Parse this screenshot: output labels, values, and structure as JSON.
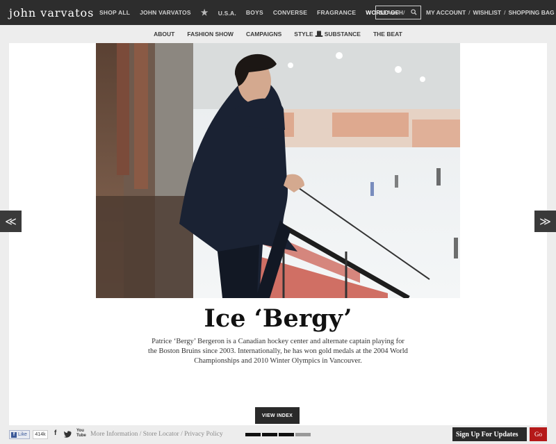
{
  "brand": {
    "logo_text": "john varvatos"
  },
  "nav": {
    "items": [
      "SHOP ALL",
      "JOHN VARVATOS",
      "U.S.A.",
      "BOYS",
      "CONVERSE",
      "FRAGRANCE",
      "WORLD OF"
    ],
    "slash": "/",
    "search_label": "SEARCH",
    "right_links": [
      "MY ACCOUNT",
      "WISHLIST",
      "SHOPPING BAG"
    ],
    "sep": "/"
  },
  "subnav": {
    "items": [
      "ABOUT",
      "FASHION SHOW",
      "CAMPAIGNS"
    ],
    "style_label": "STYLE",
    "substance_label": "SUBSTANCE",
    "last_item": "THE BEAT"
  },
  "feature": {
    "title": "Ice ‘Bergy’",
    "body": "Patrice ‘Bergy’ Bergeron is a Canadian hockey center and alternate captain playing for the Boston Bruins since 2003.  Internationally, he has won gold medals at the 2004 World Championships and 2010 Winter Olympics in Vancouver.",
    "view_index_label": "VIEW INDEX",
    "prev_glyph": "≪",
    "next_glyph": "≫"
  },
  "footer": {
    "like_label": "Like",
    "like_count": "414k",
    "facebook_glyph": "f",
    "twitter_glyph": "t",
    "youtube_label": "You Tube",
    "links": [
      "More Information",
      "Store Locator",
      "Privacy Policy"
    ],
    "link_sep": " / ",
    "pager": {
      "total": 4,
      "active": 3
    },
    "signup_label": "Sign Up For Updates",
    "go_label": "Go"
  },
  "colors": {
    "topbar": "#2d2d2d",
    "go_button": "#b51a1a",
    "page_bg": "#ededed"
  }
}
